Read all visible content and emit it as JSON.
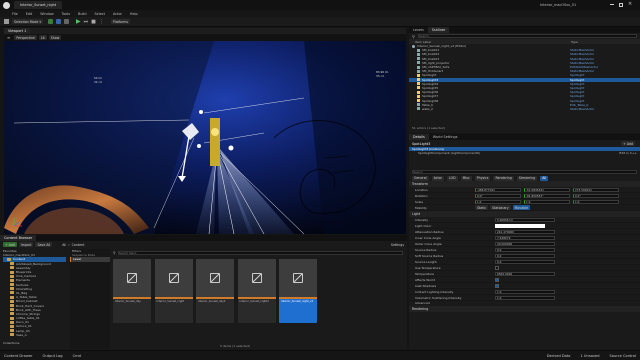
{
  "titlebar": {
    "title": "Interior_Sunset_night",
    "app_title": "Interior_macOSxx_01"
  },
  "menu": [
    "File",
    "Edit",
    "Window",
    "Tools",
    "Build",
    "Select",
    "Actor",
    "Help"
  ],
  "toolbar": {
    "mode": "Selection Mode",
    "platforms": "Platforms"
  },
  "viewport": {
    "tab": "Viewport 1",
    "buttons": [
      "Perspective",
      "Lit",
      "Show"
    ],
    "annotation_left": "54 lm\n32 cd",
    "annotation_right": "83.96 lm\n33 cd"
  },
  "outliner": {
    "tabs": [
      "Levels",
      "Outliner"
    ],
    "search_placeholder": "Search...",
    "columns": [
      "Item Label",
      "Type"
    ],
    "root": "Interior_Sunset_night_v2 (Editor)",
    "rows": [
      {
        "label": "SM_box001",
        "type": "StaticMeshActor",
        "selected": false
      },
      {
        "label": "SM_box002",
        "type": "StaticMeshActor",
        "selected": false
      },
      {
        "label": "SM_box003",
        "type": "StaticMeshActor",
        "selected": false
      },
      {
        "label": "SM_light_projector",
        "type": "StaticMeshActor",
        "selected": false
      },
      {
        "label": "SM_1SPTBAY_Sofa",
        "type": "EdStaticMeshActor",
        "selected": false
      },
      {
        "label": "SM_Hiddenart",
        "type": "StaticMeshActor",
        "selected": false
      },
      {
        "label": "SpotLight",
        "type": "SpotLight",
        "selected": false
      },
      {
        "label": "SpotLight3",
        "type": "SpotLight",
        "selected": true
      },
      {
        "label": "SpotLight4",
        "type": "SpotLight",
        "selected": false
      },
      {
        "label": "SpotLight5",
        "type": "SpotLight",
        "selected": false
      },
      {
        "label": "SpotLight6",
        "type": "SpotLight",
        "selected": false
      },
      {
        "label": "SpotLight7",
        "type": "SpotLight",
        "selected": false
      },
      {
        "label": "SpotLight8",
        "type": "SpotLight",
        "selected": false
      },
      {
        "label": "Table_b",
        "type": "EdS_Table_b",
        "selected": false
      },
      {
        "label": "walls_2",
        "type": "StaticMeshActor",
        "selected": false
      }
    ],
    "footer": "51 actors (1 selected)"
  },
  "details": {
    "tabs": [
      "Details",
      "World Settings"
    ],
    "actor_name": "SpotLight3",
    "add_label": "+ Add",
    "component_root": "SpotLight3 (Instance)",
    "component_child": "SpotLightComponent (LightComponent0)",
    "edit_label": "Edit in C++",
    "search_placeholder": "Search",
    "filter_tabs": [
      "General",
      "Actor",
      "LOD",
      "Misc",
      "Physics",
      "Rendering",
      "Streaming",
      "All"
    ],
    "transform_header": "Transform",
    "transform": [
      {
        "label": "Location",
        "values": [
          "-488.877021",
          "-51.0845441",
          "273.500011"
        ]
      },
      {
        "label": "Rotation",
        "values": [
          "0.0°",
          "-81.850567°",
          "0.0°"
        ]
      },
      {
        "label": "Scale",
        "values": [
          "1.0",
          "1.0",
          "1.0"
        ]
      }
    ],
    "mobility_label": "Mobility",
    "mobility": [
      "Static",
      "Stationary",
      "Movable"
    ],
    "light_header": "Light",
    "light_props": [
      {
        "label": "Intensity",
        "value": "5.00056 lm"
      },
      {
        "label": "Light Color",
        "value": ""
      },
      {
        "label": "Attenuation Radius",
        "value": "241.470000"
      },
      {
        "label": "Inner Cone Angle",
        "value": "7.948079"
      },
      {
        "label": "Outer Cone Angle",
        "value": "20.000000"
      },
      {
        "label": "Source Radius",
        "value": "0.0"
      },
      {
        "label": "Soft Source Radius",
        "value": "0.0"
      },
      {
        "label": "Source Length",
        "value": "0.0"
      },
      {
        "label": "Use Temperature",
        "value": ""
      },
      {
        "label": "Temperature",
        "value": "6500.0000"
      },
      {
        "label": "Affects World",
        "value": ""
      },
      {
        "label": "Cast Shadows",
        "value": ""
      },
      {
        "label": "Indirect Lighting Intensity",
        "value": "1.0"
      },
      {
        "label": "Volumetric Scattering Intensity",
        "value": "1.0"
      }
    ],
    "advanced_label": "Advanced",
    "rendering_header": "Rendering"
  },
  "content_browser": {
    "tab": "Content Browser",
    "buttons": [
      "+ Add",
      "Import",
      "Save All"
    ],
    "breadcrumb": [
      "All",
      "Content"
    ],
    "settings": "Settings",
    "filters_label": "Filters",
    "search_placeholder": "Search Maps",
    "tree_root": "Favorites",
    "project": "Interior_macOSxx_01",
    "folders": [
      "Content",
      "AdvSkies0_Background",
      "Assembly",
      "Blueprints",
      "Cine_Camera",
      "Elements",
      "textures",
      "ChairsPlug",
      "01_Bag",
      "A_Table_Table",
      "Blood_Cabinet",
      "Book_Hard_Covers",
      "Book_with_Trees",
      "Chrome_Strings",
      "coffee_table_01",
      "Deco_01",
      "lecture_01",
      "Lamp_03",
      "Vase_A"
    ],
    "collections_label": "Collections",
    "side_items": [
      "Sequence Data",
      "Level"
    ],
    "assets": [
      {
        "label": "Interior_Sunset_day",
        "selected": false
      },
      {
        "label": "Interior_Sunset_night",
        "selected": false
      },
      {
        "label": "Interior_Sunset_day2",
        "selected": false
      },
      {
        "label": "Interior_Sunset_night2",
        "selected": false
      },
      {
        "label": "Interior_Sunset_night_v2",
        "selected": true
      }
    ],
    "footer": "5 items (1 selected)"
  },
  "statusbar": {
    "left": [
      "Content Drawer",
      "Output Log",
      "Cmd"
    ],
    "right": [
      "Derived Data",
      "1 Unsaved",
      "Source Control"
    ]
  }
}
